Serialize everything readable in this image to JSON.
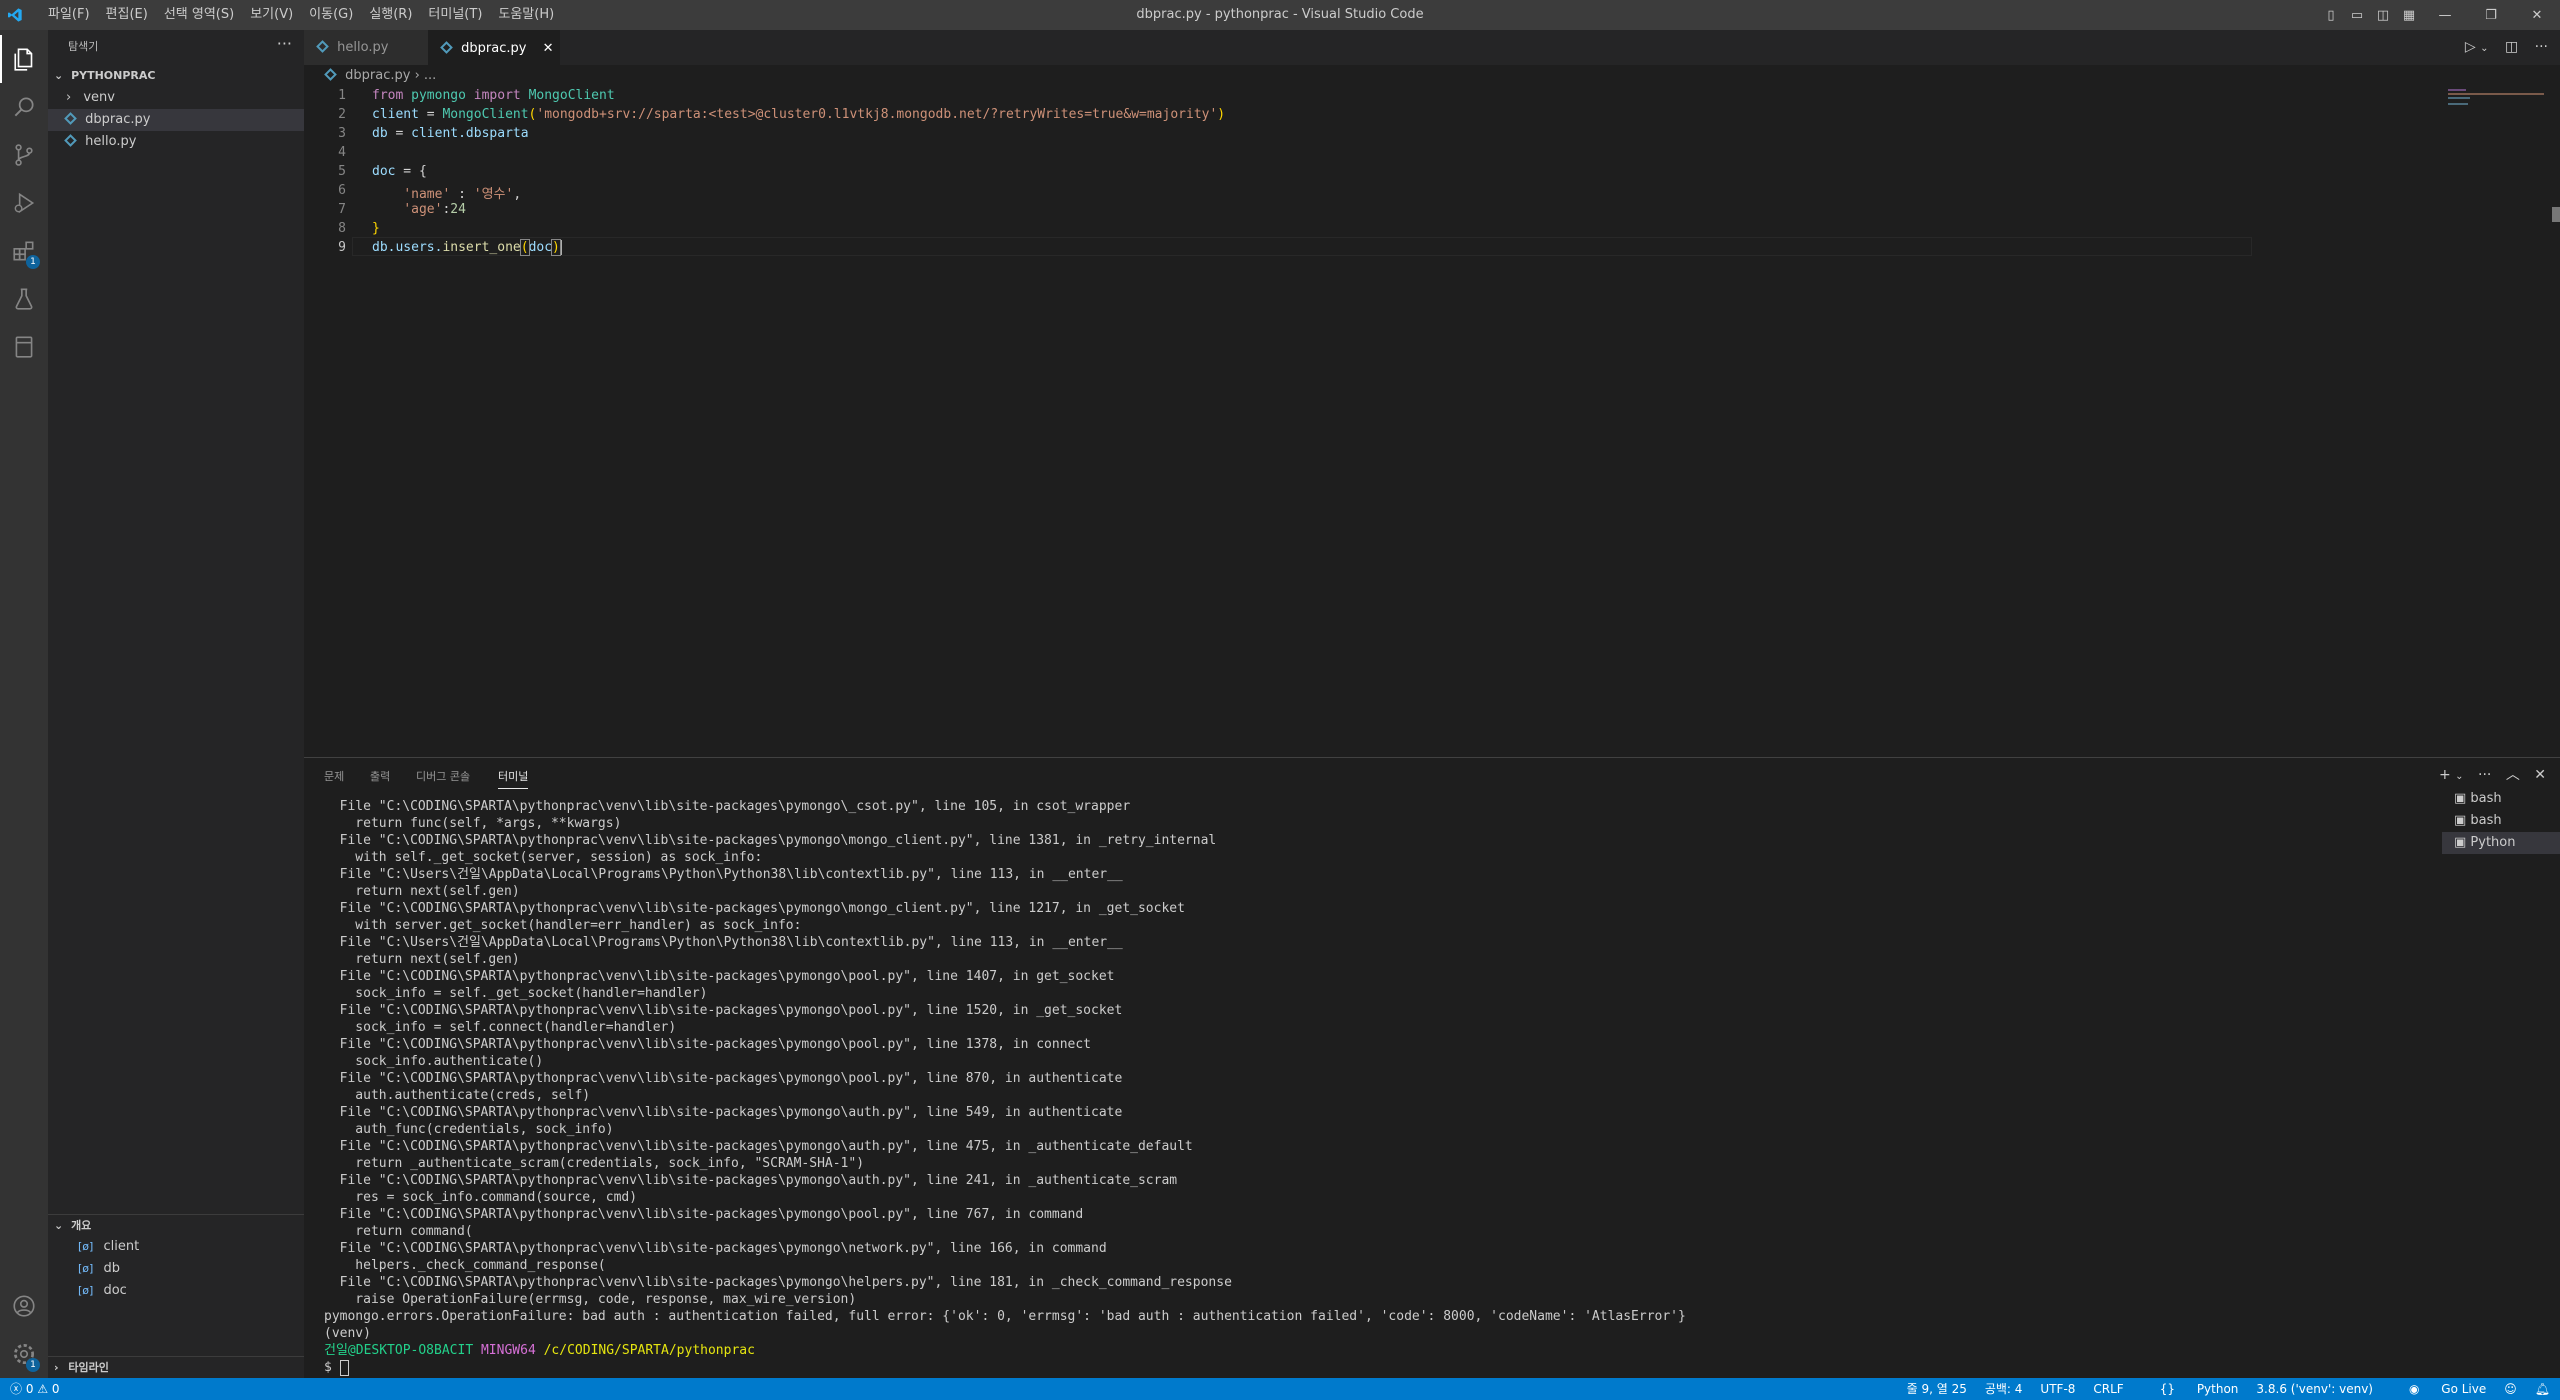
{
  "window": {
    "title": "dbprac.py - pythonprac - Visual Studio Code"
  },
  "menu": [
    "파일(F)",
    "편집(E)",
    "선택 영역(S)",
    "보기(V)",
    "이동(G)",
    "실행(R)",
    "터미널(T)",
    "도움말(H)"
  ],
  "sidebar": {
    "title": "탐색기",
    "folder": "PYTHONPRAC",
    "items": [
      {
        "label": "venv",
        "type": "folder"
      },
      {
        "label": "dbprac.py",
        "type": "python"
      },
      {
        "label": "hello.py",
        "type": "python"
      }
    ],
    "outline": {
      "title": "개요",
      "items": [
        "client",
        "db",
        "doc"
      ]
    },
    "timeline": {
      "title": "타임라인"
    }
  },
  "activity": {
    "extensions_badge": "1",
    "settings_badge": "1"
  },
  "tabs": [
    {
      "label": "hello.py",
      "active": false
    },
    {
      "label": "dbprac.py",
      "active": true
    }
  ],
  "breadcrumb": {
    "file": "dbprac.py",
    "rest": "..."
  },
  "code": {
    "line_numbers": [
      "1",
      "2",
      "3",
      "4",
      "5",
      "6",
      "7",
      "8",
      "9"
    ],
    "l1_from": "from",
    "l1_mod": "pymongo",
    "l1_import": "import",
    "l1_cls": "MongoClient",
    "l2_var": "client",
    "l2_eq": " = ",
    "l2_cls": "MongoClient",
    "l2_open": "(",
    "l2_str": "'mongodb+srv://sparta:<test>@cluster0.l1vtkj8.mongodb.net/?retryWrites=true&w=majority'",
    "l2_close": ")",
    "l3_var": "db",
    "l3_eq": " = ",
    "l3_obj": "client",
    "l3_attr": ".dbsparta",
    "l5_var": "doc",
    "l5_rest": " = {",
    "l6_key": "'name'",
    "l6_sep": " : ",
    "l6_val": "'영수'",
    "l6_end": ",",
    "l7_key": "'age'",
    "l7_sep": ":",
    "l7_val": "24",
    "l8": "}",
    "l9_obj": "db",
    "l9_mid": ".users.",
    "l9_fn": "insert_one",
    "l9_open": "(",
    "l9_arg": "doc",
    "l9_close": ")"
  },
  "panel": {
    "tabs": [
      "문제",
      "출력",
      "디버그 콘솔",
      "터미널"
    ],
    "active_tab": "터미널",
    "terminals": [
      "bash",
      "bash",
      "Python"
    ],
    "terminal_lines": [
      "  File \"C:\\CODING\\SPARTA\\pythonprac\\venv\\lib\\site-packages\\pymongo\\_csot.py\", line 105, in csot_wrapper",
      "    return func(self, *args, **kwargs)",
      "  File \"C:\\CODING\\SPARTA\\pythonprac\\venv\\lib\\site-packages\\pymongo\\mongo_client.py\", line 1381, in _retry_internal",
      "    with self._get_socket(server, session) as sock_info:",
      "  File \"C:\\Users\\건일\\AppData\\Local\\Programs\\Python\\Python38\\lib\\contextlib.py\", line 113, in __enter__",
      "    return next(self.gen)",
      "  File \"C:\\CODING\\SPARTA\\pythonprac\\venv\\lib\\site-packages\\pymongo\\mongo_client.py\", line 1217, in _get_socket",
      "    with server.get_socket(handler=err_handler) as sock_info:",
      "  File \"C:\\Users\\건일\\AppData\\Local\\Programs\\Python\\Python38\\lib\\contextlib.py\", line 113, in __enter__",
      "    return next(self.gen)",
      "  File \"C:\\CODING\\SPARTA\\pythonprac\\venv\\lib\\site-packages\\pymongo\\pool.py\", line 1407, in get_socket",
      "    sock_info = self._get_socket(handler=handler)",
      "  File \"C:\\CODING\\SPARTA\\pythonprac\\venv\\lib\\site-packages\\pymongo\\pool.py\", line 1520, in _get_socket",
      "    sock_info = self.connect(handler=handler)",
      "  File \"C:\\CODING\\SPARTA\\pythonprac\\venv\\lib\\site-packages\\pymongo\\pool.py\", line 1378, in connect",
      "    sock_info.authenticate()",
      "  File \"C:\\CODING\\SPARTA\\pythonprac\\venv\\lib\\site-packages\\pymongo\\pool.py\", line 870, in authenticate",
      "    auth.authenticate(creds, self)",
      "  File \"C:\\CODING\\SPARTA\\pythonprac\\venv\\lib\\site-packages\\pymongo\\auth.py\", line 549, in authenticate",
      "    auth_func(credentials, sock_info)",
      "  File \"C:\\CODING\\SPARTA\\pythonprac\\venv\\lib\\site-packages\\pymongo\\auth.py\", line 475, in _authenticate_default",
      "    return _authenticate_scram(credentials, sock_info, \"SCRAM-SHA-1\")",
      "  File \"C:\\CODING\\SPARTA\\pythonprac\\venv\\lib\\site-packages\\pymongo\\auth.py\", line 241, in _authenticate_scram",
      "    res = sock_info.command(source, cmd)",
      "  File \"C:\\CODING\\SPARTA\\pythonprac\\venv\\lib\\site-packages\\pymongo\\pool.py\", line 767, in command",
      "    return command(",
      "  File \"C:\\CODING\\SPARTA\\pythonprac\\venv\\lib\\site-packages\\pymongo\\network.py\", line 166, in command",
      "    helpers._check_command_response(",
      "  File \"C:\\CODING\\SPARTA\\pythonprac\\venv\\lib\\site-packages\\pymongo\\helpers.py\", line 181, in _check_command_response",
      "    raise OperationFailure(errmsg, code, response, max_wire_version)",
      "pymongo.errors.OperationFailure: bad auth : authentication failed, full error: {'ok': 0, 'errmsg': 'bad auth : authentication failed', 'code': 8000, 'codeName': 'AtlasError'}",
      "(venv)"
    ],
    "prompt": {
      "user": "건일@DESKTOP-O8BACIT",
      "shell": "MINGW64",
      "path": "/c/CODING/SPARTA/pythonprac",
      "symbol": "$"
    }
  },
  "statusbar": {
    "errors": "0",
    "warnings": "0",
    "position": "줄 9, 열 25",
    "spaces": "공백: 4",
    "encoding": "UTF-8",
    "eol": "CRLF",
    "language": "Python",
    "interpreter": "3.8.6 ('venv': venv)",
    "golive": "Go Live"
  },
  "colors": {
    "statusbar": "#007acc",
    "accent": "#0e639c"
  }
}
